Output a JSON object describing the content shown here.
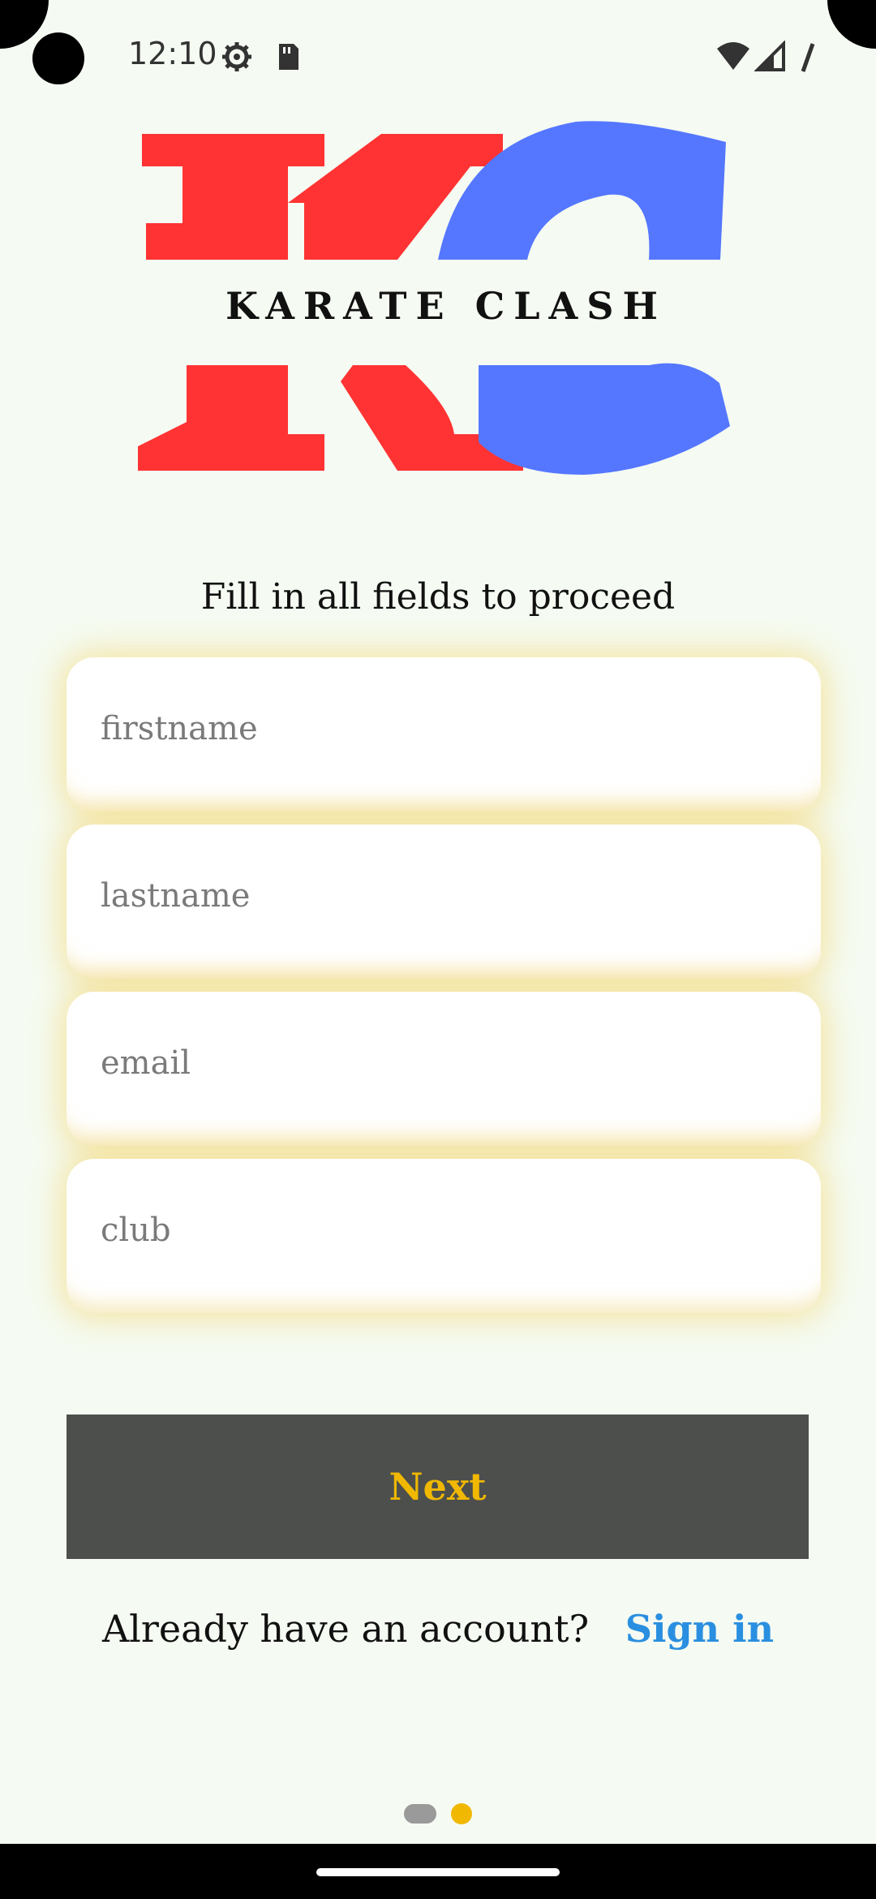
{
  "status_bar": {
    "time": "12:10",
    "icons": [
      "settings-gear-icon",
      "sd-card-icon",
      "wifi-icon",
      "cell-signal-icon",
      "battery-icon"
    ]
  },
  "logo": {
    "text": "KARATE CLASH",
    "colors": {
      "red": "#FF3333",
      "blue": "#5577FF"
    }
  },
  "form": {
    "instruction": "Fill in all fields to proceed",
    "fields": [
      {
        "placeholder": "firstname",
        "value": ""
      },
      {
        "placeholder": "lastname",
        "value": ""
      },
      {
        "placeholder": "email",
        "value": ""
      },
      {
        "placeholder": "club",
        "value": ""
      }
    ],
    "next_label": "Next"
  },
  "footer": {
    "prompt": "Already have an account?",
    "signin_label": "Sign in"
  },
  "pagination": {
    "total": 2,
    "active_index": 1
  },
  "colors": {
    "background": "#F5FBF2",
    "button_bg": "#4D4F4C",
    "button_text": "#F0B800",
    "link": "#2A8FE0",
    "field_glow": "#F5C83C"
  }
}
